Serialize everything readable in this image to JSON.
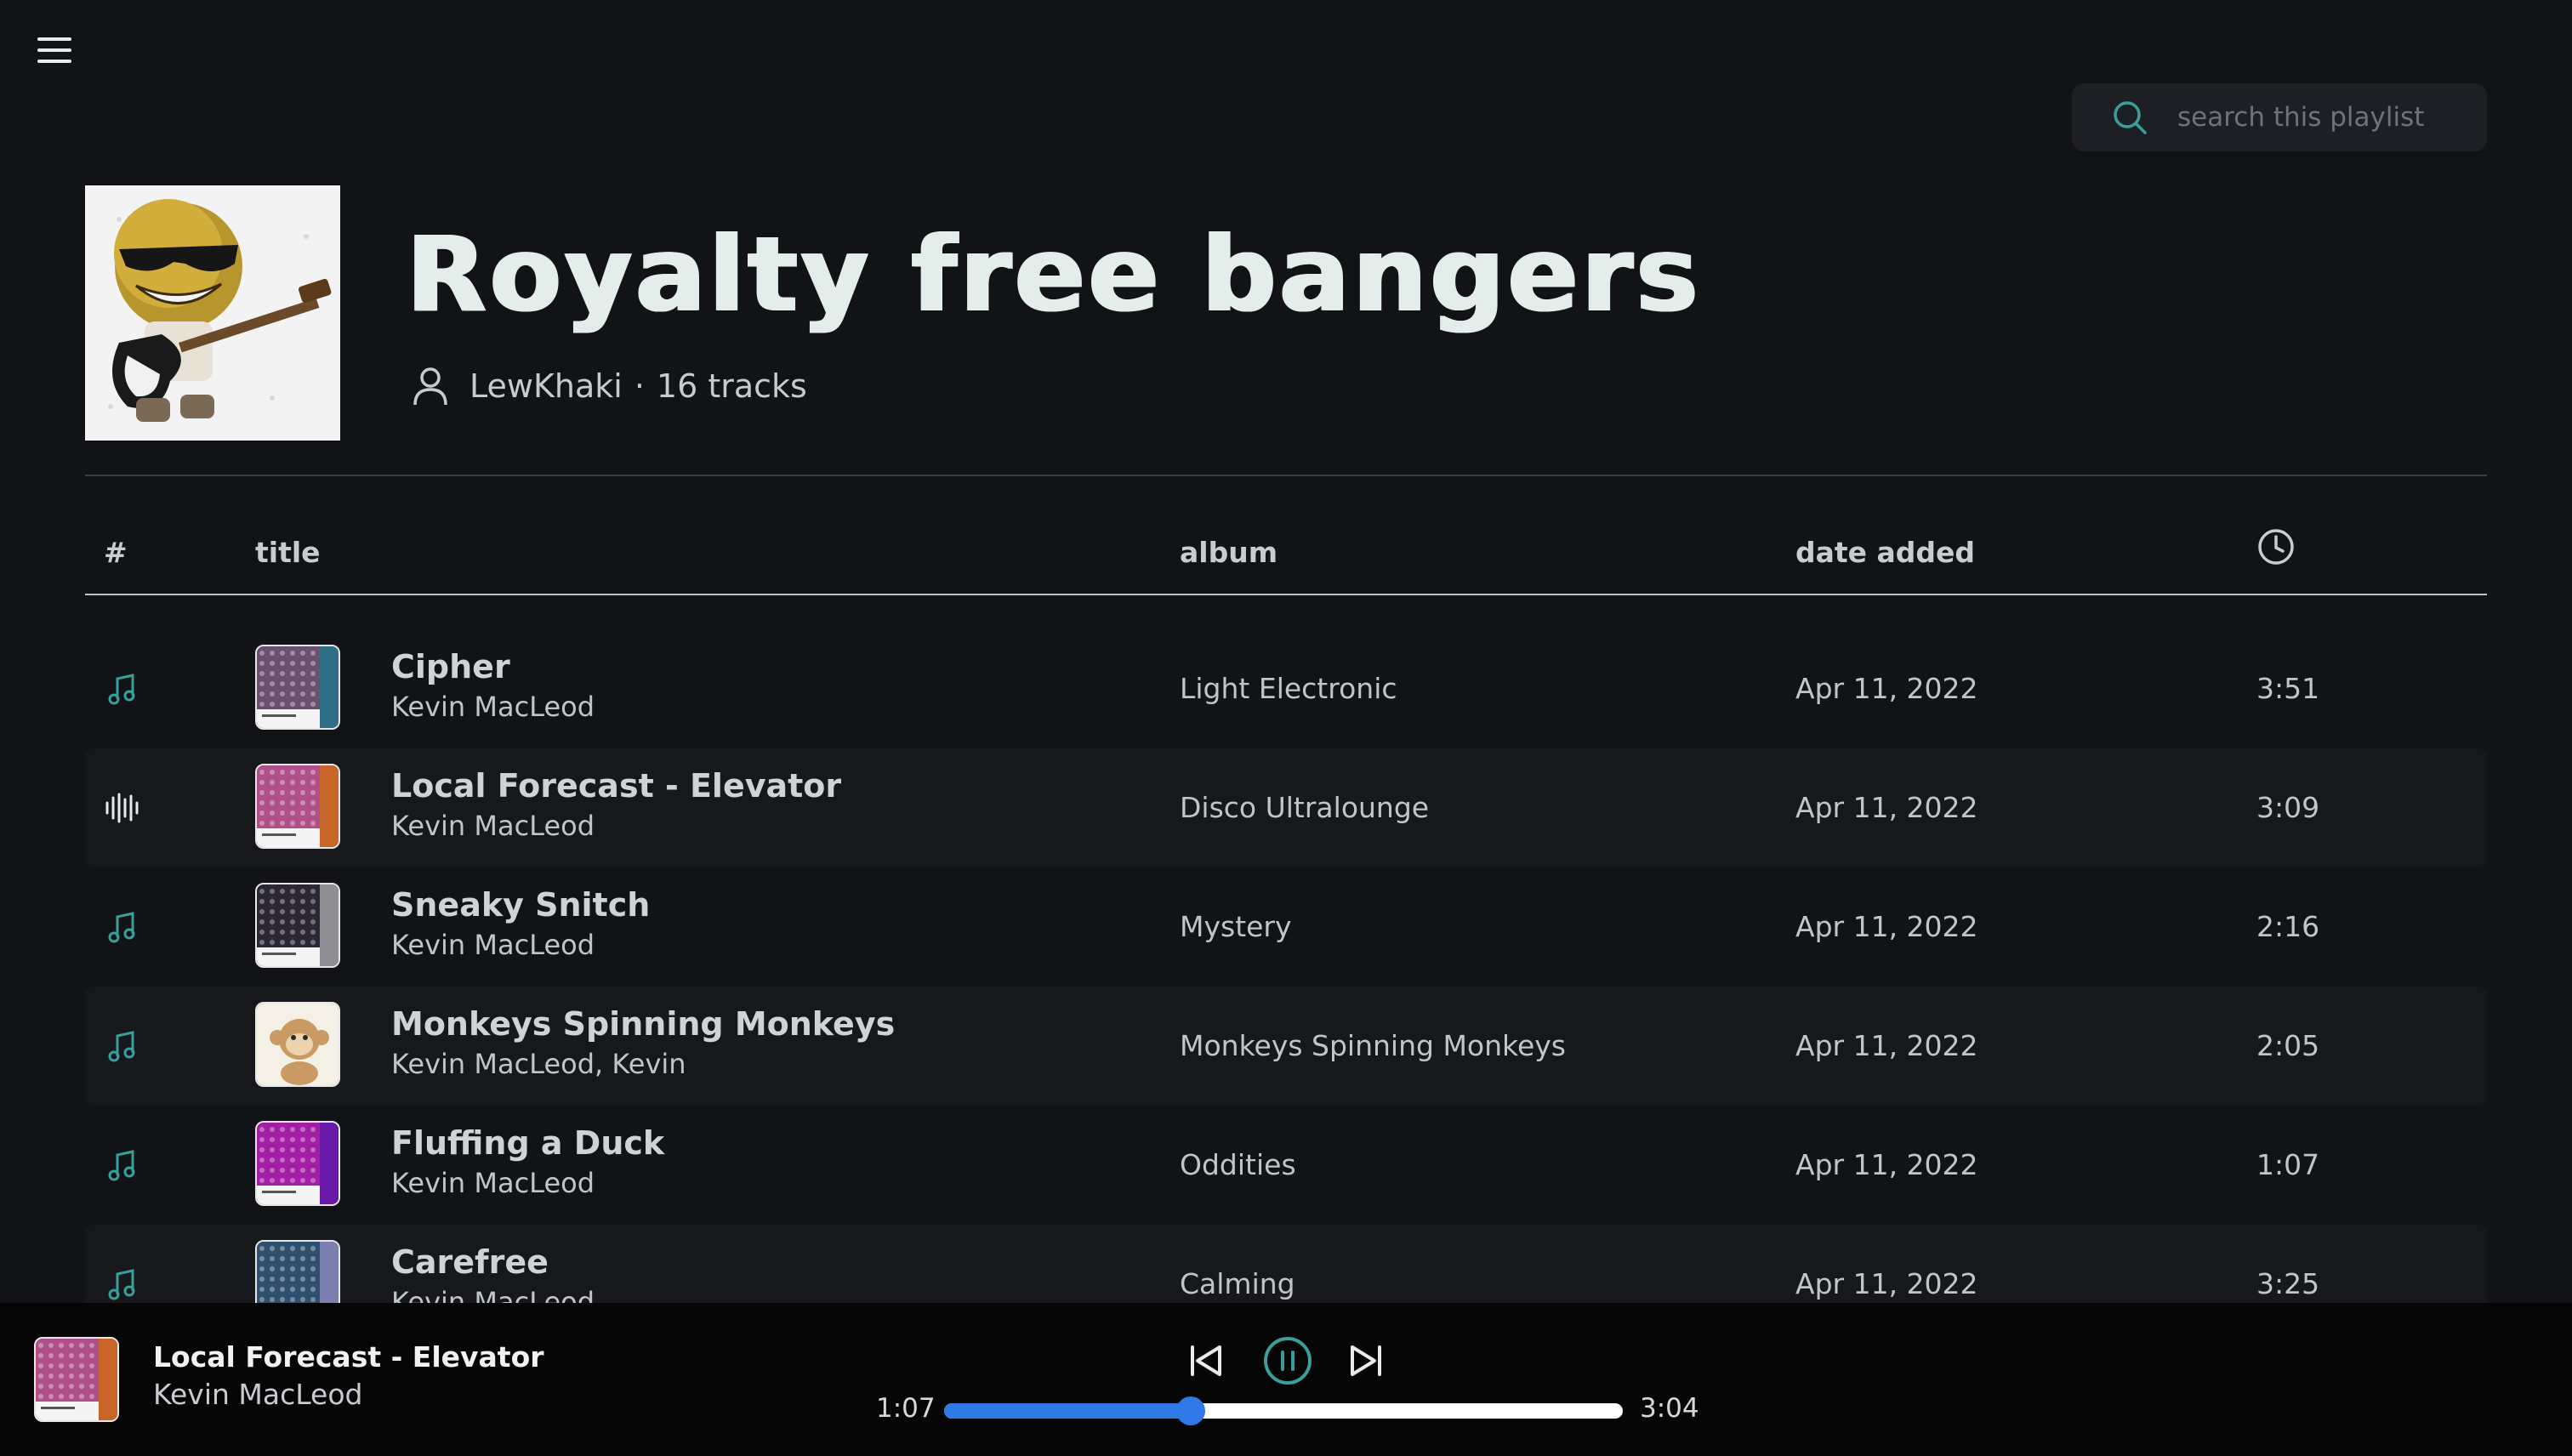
{
  "search": {
    "placeholder": "search this playlist"
  },
  "playlist": {
    "title": "Royalty free bangers",
    "owner": "LewKhaki",
    "separator": "·",
    "track_count": "16 tracks"
  },
  "table": {
    "headers": {
      "index": "#",
      "title": "title",
      "album": "album",
      "date": "date added",
      "duration_icon": "clock-icon"
    },
    "rows": [
      {
        "title": "Cipher",
        "artist": "Kevin MacLeod",
        "album": "Light Electronic",
        "date": "Apr 11, 2022",
        "duration": "3:51",
        "state": "music-note-icon",
        "art_main": "#6b4f6f",
        "art_side": "#2f6f86"
      },
      {
        "title": "Local Forecast - Elevator",
        "artist": "Kevin MacLeod",
        "album": "Disco Ultralounge",
        "date": "Apr 11, 2022",
        "duration": "3:09",
        "state": "waveform-icon",
        "art_main": "#b0508a",
        "art_side": "#c8662a"
      },
      {
        "title": "Sneaky Snitch",
        "artist": "Kevin MacLeod",
        "album": "Mystery",
        "date": "Apr 11, 2022",
        "duration": "2:16",
        "state": "music-note-icon",
        "art_main": "#2b2634",
        "art_side": "#8e8e94"
      },
      {
        "title": "Monkeys Spinning Monkeys",
        "artist": "Kevin MacLeod, Kevin",
        "album": "Monkeys Spinning Monkeys",
        "date": "Apr 11, 2022",
        "duration": "2:05",
        "state": "music-note-icon",
        "art_main": "#f5f0e6",
        "art_side": "#f5f0e6"
      },
      {
        "title": "Fluffing a Duck",
        "artist": "Kevin MacLeod",
        "album": "Oddities",
        "date": "Apr 11, 2022",
        "duration": "1:07",
        "state": "music-note-icon",
        "art_main": "#a21ea5",
        "art_side": "#6a1aa8"
      },
      {
        "title": "Carefree",
        "artist": "Kevin MacLeod",
        "album": "Calming",
        "date": "Apr 11, 2022",
        "duration": "3:25",
        "state": "music-note-icon",
        "art_main": "#2f4f6f",
        "art_side": "#7a7fb0"
      }
    ]
  },
  "player": {
    "title": "Local Forecast - Elevator",
    "artist": "Kevin MacLeod",
    "elapsed": "1:07",
    "total": "3:04",
    "progress_fraction": 0.364,
    "art_main": "#b0508a",
    "art_side": "#c8662a"
  },
  "colors": {
    "accent": "#2f78e5",
    "icon_teal": "#3a9e9a",
    "background": "#121316"
  }
}
